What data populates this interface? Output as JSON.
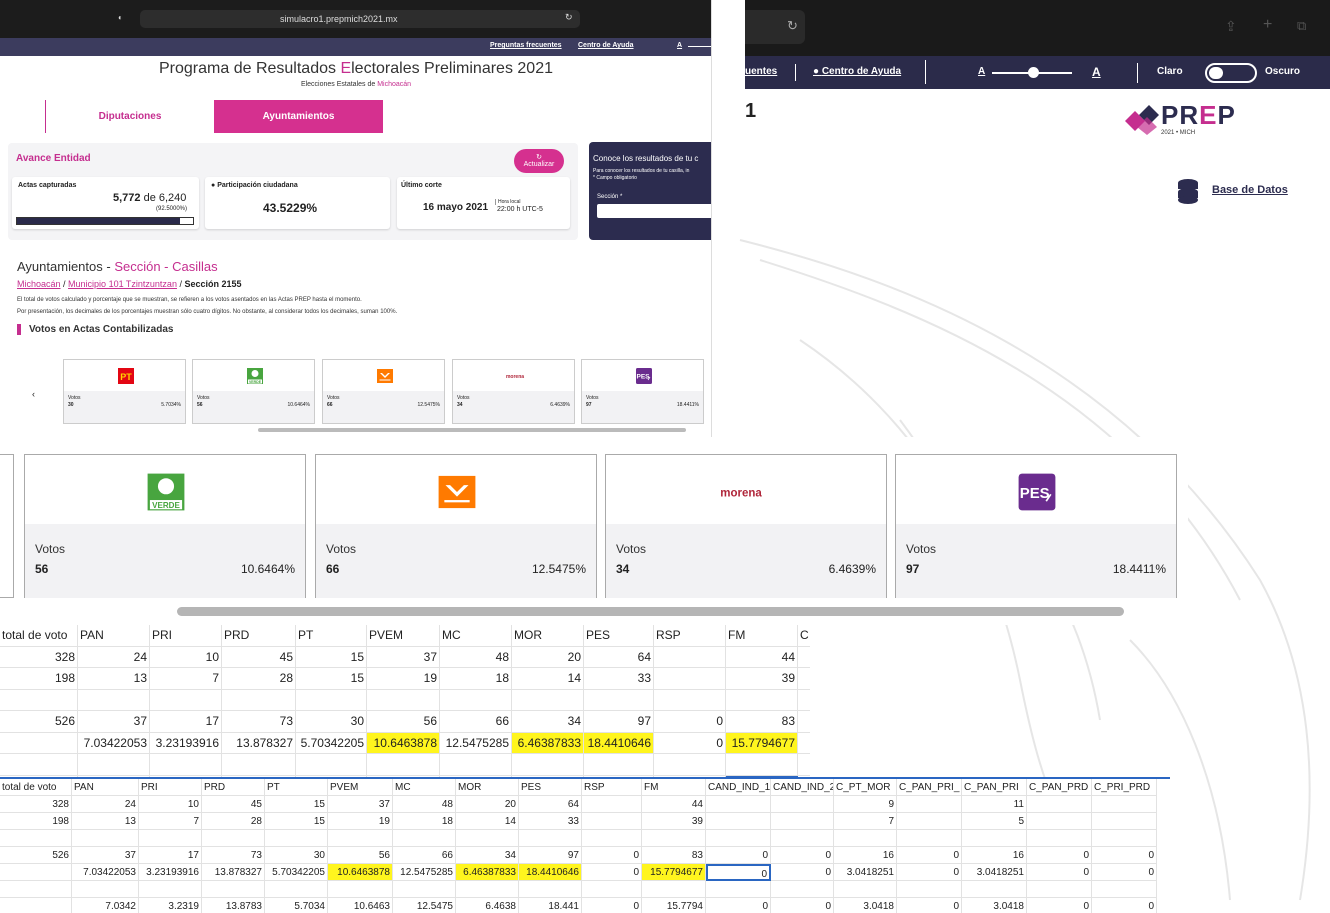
{
  "browser": {
    "url": "simulacro1.prepmich2021.mx"
  },
  "topnav": {
    "faq": "Preguntas frecuentes",
    "help": "Centro de Ayuda",
    "font_small": "A"
  },
  "header": {
    "title_pre": "Programa de Resultados ",
    "title_e": "E",
    "title_post": "lectorales Preliminares 2021",
    "subtitle_pre": "Elecciones Estatales de ",
    "subtitle_state": "Michoacán"
  },
  "tabs": {
    "diputaciones": "Diputaciones",
    "ayuntamientos": "Ayuntamientos"
  },
  "avance": {
    "title": "Avance Entidad",
    "update": "Actualizar",
    "actas_label": "Actas capturadas",
    "actas_value": "5,772",
    "actas_of": "de 6,240",
    "actas_pct": "(92.5000%)",
    "actas_progress": 0.925,
    "part_label": "Participación ciudadana",
    "part_value": "43.5229%",
    "corte_label": "Último corte",
    "corte_date": "16 mayo 2021",
    "corte_local": "Hora local",
    "corte_time": "22:00 h UTC-5"
  },
  "conoce": {
    "title": "Conoce los resultados de tu c",
    "line1": "Para conocer los resultados de tu casilla, in",
    "line2": "* Campo obligatorio",
    "field": "Sección *"
  },
  "section": {
    "pre": "Ayuntamientos - ",
    "highlight": "Sección - Casillas",
    "bc1": "Michoacán",
    "bc2": "Municipio 101 Tzintzuntzan",
    "bc3": "Sección 2155",
    "note1": "El total de votos calculado y porcentaje que se muestran, se refieren a los votos asentados en las Actas PREP hasta el momento.",
    "note2": "Por presentación, los decimales de los porcentajes muestran sólo cuatro dígitos. No obstante, al considerar todos los decimales, suman 100%.",
    "votos_title": "Votos en Actas Contabilizadas"
  },
  "small_cards": [
    {
      "party": "PT",
      "label": "Votos",
      "votes": "30",
      "pct": "5.7034%"
    },
    {
      "party": "VERDE",
      "label": "Votos",
      "votes": "56",
      "pct": "10.6464%"
    },
    {
      "party": "MC",
      "label": "Votos",
      "votes": "66",
      "pct": "12.5475%"
    },
    {
      "party": "morena",
      "label": "Votos",
      "votes": "34",
      "pct": "6.4639%"
    },
    {
      "party": "PES",
      "label": "Votos",
      "votes": "97",
      "pct": "18.4411%"
    }
  ],
  "panel2": {
    "nav_freq": "uentes",
    "nav_help": "Centro de Ayuda",
    "a_small": "A",
    "a_big": "A",
    "claro": "Claro",
    "oscuro": "Oscuro",
    "logo_pre": "PR",
    "logo_e": "E",
    "logo_post": "P",
    "logo_sub": "2021 • MICH",
    "base": "Base de Datos",
    "title_frag": "1"
  },
  "big_cards": [
    {
      "party": "VERDE",
      "label": "Votos",
      "votes": "56",
      "pct": "10.6464%"
    },
    {
      "party": "MC",
      "label": "Votos",
      "votes": "66",
      "pct": "12.5475%"
    },
    {
      "party": "morena",
      "label": "Votos",
      "votes": "34",
      "pct": "6.4639%"
    },
    {
      "party": "PES",
      "label": "Votos",
      "votes": "97",
      "pct": "18.4411%"
    }
  ],
  "sheet1": {
    "header": [
      "total de voto",
      "PAN",
      "PRI",
      "PRD",
      "PT",
      "PVEM",
      "MC",
      "MOR",
      "PES",
      "RSP",
      "FM",
      "C"
    ],
    "rows": [
      [
        "328",
        "24",
        "10",
        "45",
        "15",
        "37",
        "48",
        "20",
        "64",
        "",
        "44",
        ""
      ],
      [
        "198",
        "13",
        "7",
        "28",
        "15",
        "19",
        "18",
        "14",
        "33",
        "",
        "39",
        ""
      ],
      [
        "",
        "",
        "",
        "",
        "",
        "",
        "",
        "",
        "",
        "",
        "",
        ""
      ],
      [
        "526",
        "37",
        "17",
        "73",
        "30",
        "56",
        "66",
        "34",
        "97",
        "0",
        "83",
        ""
      ],
      [
        "",
        "7.03422053",
        "3.23193916",
        "13.878327",
        "5.70342205",
        "10.6463878",
        "12.5475285",
        "6.46387833",
        "18.4410646",
        "0",
        "15.7794677",
        ""
      ],
      [
        "",
        "",
        "",
        "",
        "",
        "",
        "",
        "",
        "",
        "",
        "",
        ""
      ],
      [
        "",
        "7.0342",
        "3.2319",
        "13.8783",
        "5.7034",
        "10.6463",
        "12.5475",
        "6.4638",
        "18.441",
        "0",
        "15.7794",
        ""
      ]
    ]
  },
  "sheet2": {
    "header": [
      "total de voto",
      "PAN",
      "PRI",
      "PRD",
      "PT",
      "PVEM",
      "MC",
      "MOR",
      "PES",
      "RSP",
      "FM",
      "CAND_IND_1",
      "CAND_IND_2",
      "C_PT_MOR",
      "C_PAN_PRI_",
      "C_PAN_PRI",
      "C_PAN_PRD",
      "C_PRI_PRD"
    ],
    "rows": [
      [
        "328",
        "24",
        "10",
        "45",
        "15",
        "37",
        "48",
        "20",
        "64",
        "",
        "44",
        "",
        "",
        "9",
        "",
        "11",
        "",
        ""
      ],
      [
        "198",
        "13",
        "7",
        "28",
        "15",
        "19",
        "18",
        "14",
        "33",
        "",
        "39",
        "",
        "",
        "7",
        "",
        "5",
        "",
        ""
      ],
      [
        "",
        "",
        "",
        "",
        "",
        "",
        "",
        "",
        "",
        "",
        "",
        "",
        "",
        "",
        "",
        "",
        "",
        ""
      ],
      [
        "526",
        "37",
        "17",
        "73",
        "30",
        "56",
        "66",
        "34",
        "97",
        "0",
        "83",
        "0",
        "0",
        "16",
        "0",
        "16",
        "0",
        "0"
      ],
      [
        "",
        "7.03422053",
        "3.23193916",
        "13.878327",
        "5.70342205",
        "10.6463878",
        "12.5475285",
        "6.46387833",
        "18.4410646",
        "0",
        "15.7794677",
        "0",
        "0",
        "3.0418251",
        "0",
        "3.0418251",
        "0",
        "0"
      ],
      [
        "",
        "",
        "",
        "",
        "",
        "",
        "",
        "",
        "",
        "",
        "",
        "",
        "",
        "",
        "",
        "",
        "",
        ""
      ],
      [
        "",
        "7.0342",
        "3.2319",
        "13.8783",
        "5.7034",
        "10.6463",
        "12.5475",
        "6.4638",
        "18.441",
        "0",
        "15.7794",
        "0",
        "0",
        "3.0418",
        "0",
        "3.0418",
        "0",
        "0"
      ]
    ]
  },
  "colors": {
    "brand": "#c52e8f",
    "navy": "#2c2c4f",
    "highlight": "#fff51e"
  }
}
